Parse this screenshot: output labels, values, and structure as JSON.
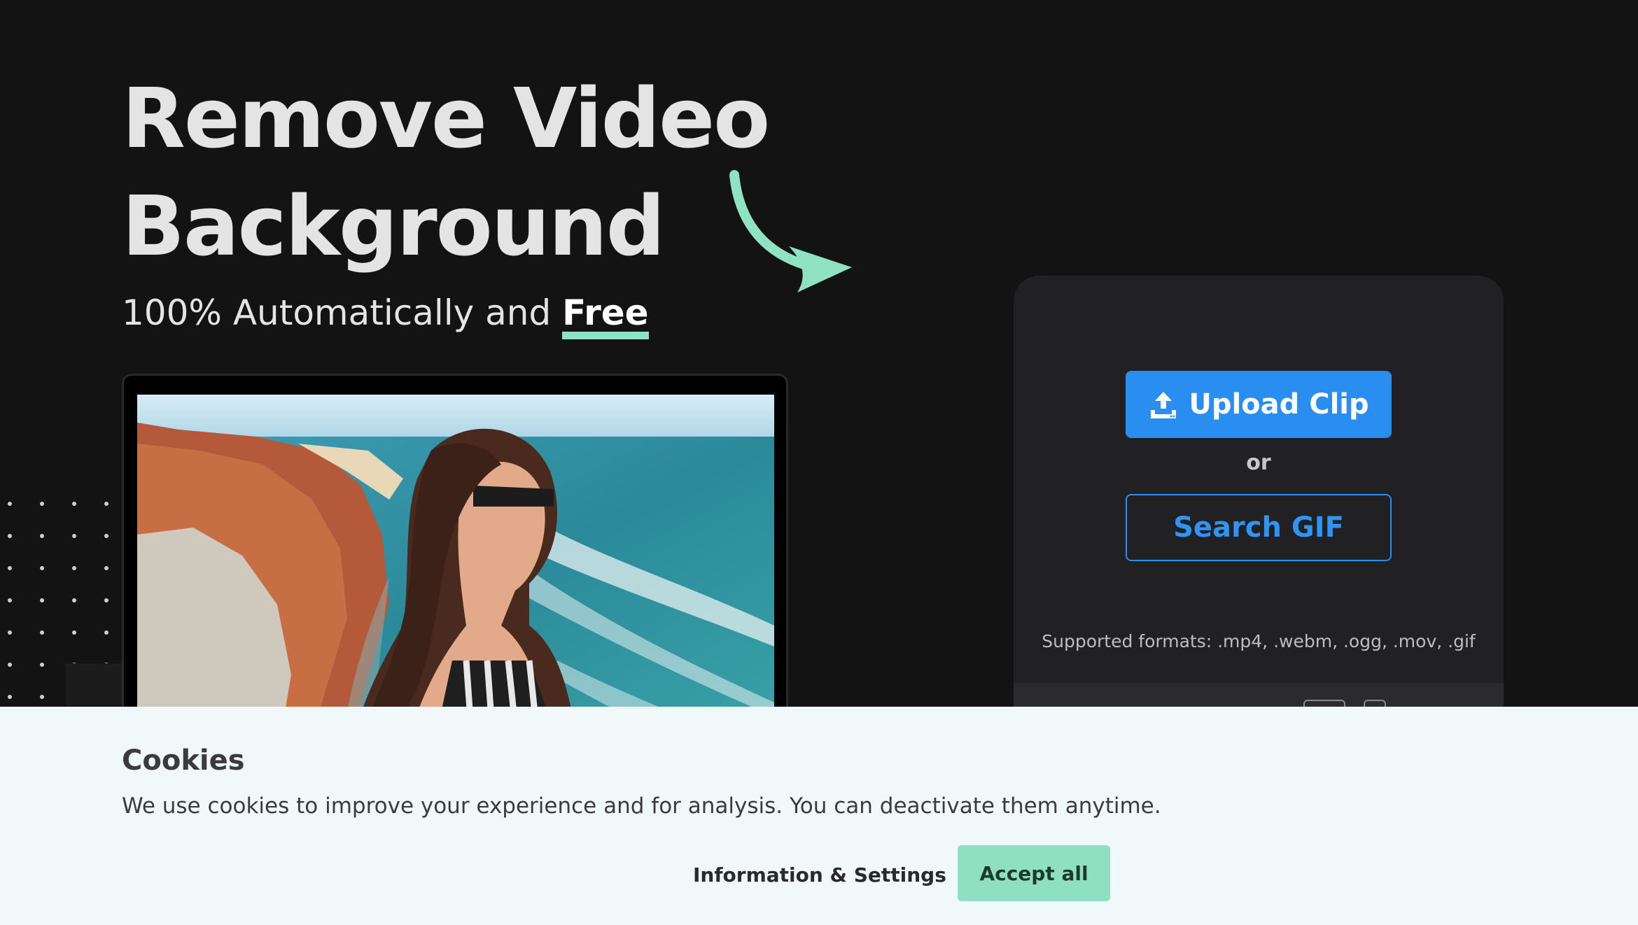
{
  "hero": {
    "title_line1": "Remove Video",
    "title_line2": "Background",
    "subtitle_prefix": "100% Automatically and ",
    "subtitle_emphasis": "Free"
  },
  "upload": {
    "upload_label": "Upload Clip",
    "or_label": "or",
    "search_label": "Search GIF",
    "formats": "Supported formats: .mp4, .webm, .ogg, .mov, .gif"
  },
  "cookies": {
    "title": "Cookies",
    "text": "We use cookies to improve your experience and for analysis. You can deactivate them anytime.",
    "info_label": "Information & Settings",
    "accept_label": "Accept all"
  },
  "icons": {
    "upload": "upload-icon",
    "arrow": "curved-arrow-icon"
  },
  "colors": {
    "background": "#131314",
    "card": "#212123",
    "primary_blue": "#2a8ef0",
    "accent_mint": "#8fe3c4",
    "banner": "#f1f8f9"
  }
}
